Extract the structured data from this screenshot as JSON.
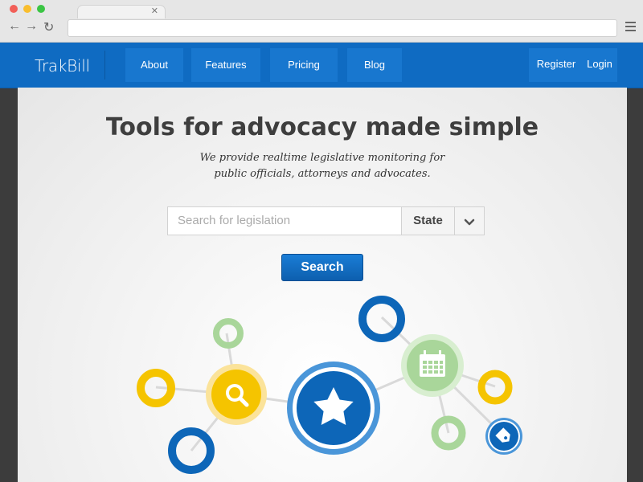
{
  "brand": {
    "name": "TrakBill"
  },
  "nav": {
    "items": [
      {
        "label": "About"
      },
      {
        "label": "Features"
      },
      {
        "label": "Pricing"
      },
      {
        "label": "Blog"
      }
    ],
    "register": "Register",
    "login": "Login"
  },
  "hero": {
    "title": "Tools for advocacy made simple",
    "subtitle_line1": "We provide realtime legislative monitoring for",
    "subtitle_line2": "public officials, attorneys and advocates."
  },
  "search": {
    "placeholder": "Search for legislation",
    "state_label": "State",
    "button_label": "Search"
  },
  "colors": {
    "brand_blue": "#0f6bc2",
    "yellow": "#f5c400",
    "green": "#a9d69a",
    "dark_blue": "#0d66b8"
  },
  "icons": [
    "search-icon",
    "star-icon",
    "calendar-icon",
    "tag-icon",
    "chevron-down-icon",
    "hamburger-menu-icon",
    "back-arrow-icon",
    "forward-arrow-icon",
    "reload-icon",
    "close-icon"
  ]
}
